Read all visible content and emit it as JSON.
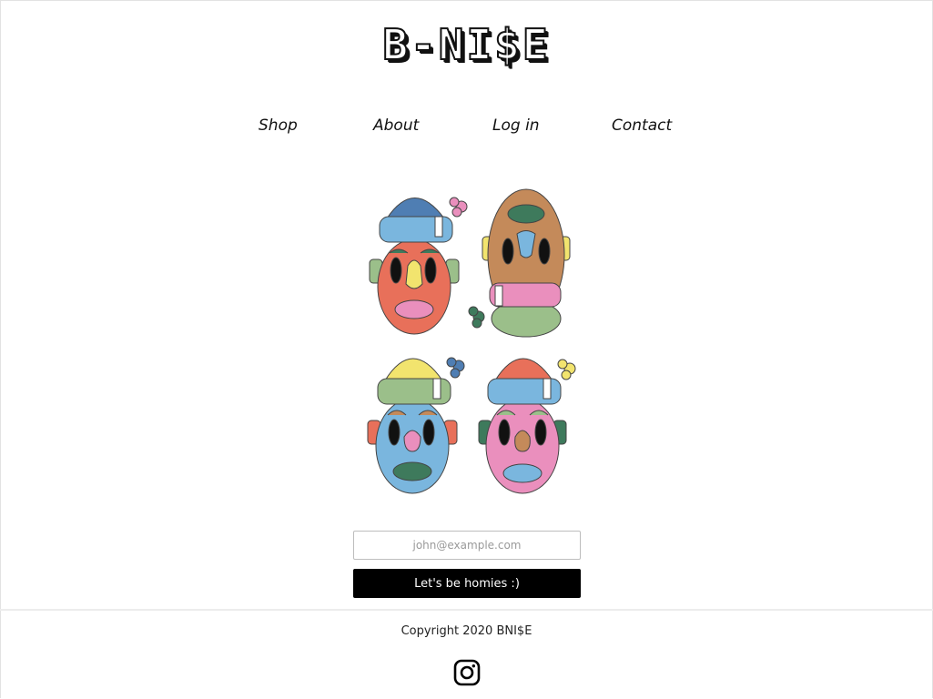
{
  "header": {
    "logo_text": "B-NI$E"
  },
  "nav": {
    "items": [
      {
        "label": "Shop"
      },
      {
        "label": "About"
      },
      {
        "label": "Log in"
      },
      {
        "label": "Contact"
      }
    ]
  },
  "hero": {
    "image_icon": "four-faces-illustration"
  },
  "signup": {
    "email_placeholder": "john@example.com",
    "email_value": "",
    "button_label": "Let's be homies :)"
  },
  "footer": {
    "copyright": "Copyright 2020 BNI$E",
    "social_icon": "instagram-icon"
  },
  "colors": {
    "accent": "#000000",
    "blue_hat": "#4f7eb3",
    "light_blue": "#7ab6de",
    "coral": "#e8705a",
    "tan": "#c48a5a",
    "pink": "#ea8fbd",
    "yellow": "#f2e46e",
    "sage": "#9bbf8a",
    "dark_green": "#3e7a5c"
  }
}
